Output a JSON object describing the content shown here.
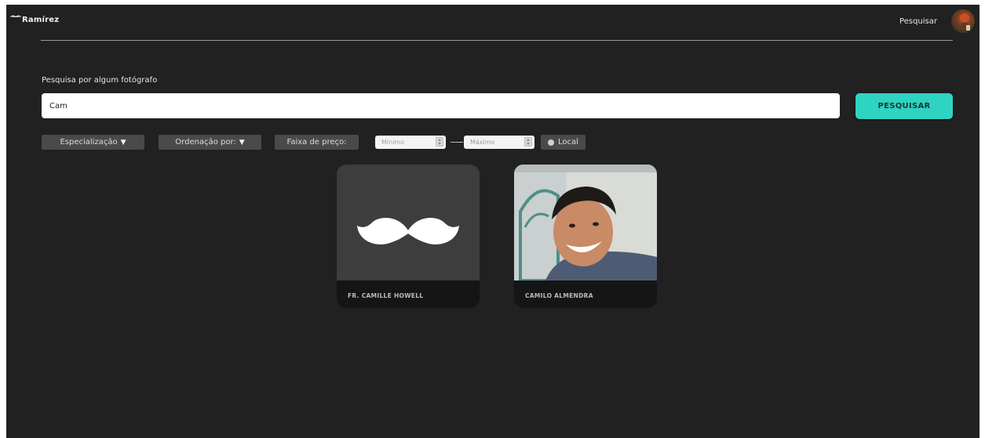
{
  "header": {
    "logo_text": "Ramirez",
    "logo_display": "Ramírez",
    "nav_search": "Pesquisar"
  },
  "search": {
    "label": "Pesquisa por algum fotógrafo",
    "value": "Cam",
    "button": "PESQUISAR"
  },
  "filters": {
    "specialization": "Especialização",
    "ordering": "Ordenação por:",
    "price_range": "Faixa de preço:",
    "min_placeholder": "Mínimo",
    "max_placeholder": "Máximo",
    "local": "Local"
  },
  "results": [
    {
      "name": "FR. CAMILLE HOWELL",
      "image": "mustache-placeholder"
    },
    {
      "name": "CAMILO ALMENDRA",
      "image": "profile-photo"
    }
  ],
  "colors": {
    "background": "#212121",
    "accent": "#2fd3c1",
    "chip": "#4a4a4a",
    "card_placeholder": "#3d3d3d"
  }
}
